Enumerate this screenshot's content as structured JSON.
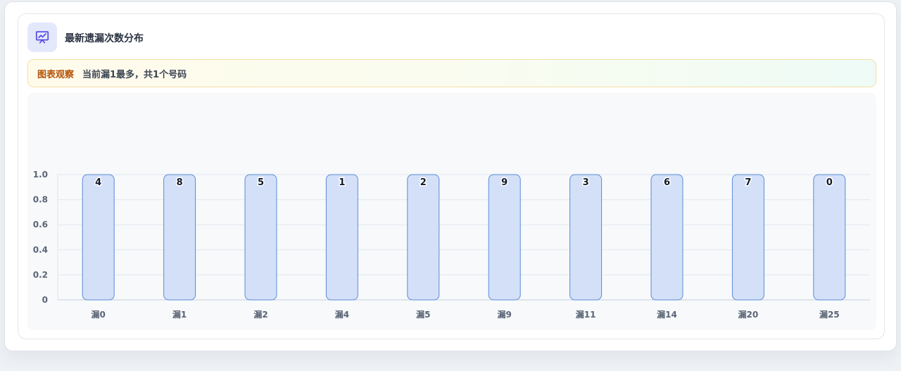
{
  "header": {
    "title": "最新遗漏次数分布",
    "icon": "presentation-chart-icon"
  },
  "observation": {
    "label": "图表观察",
    "text": "当前漏1最多，共1个号码"
  },
  "colors": {
    "bar_fill": "#d3e0f8",
    "bar_stroke": "#5b8bd9",
    "axis_text": "#5b6576",
    "label_text": "#111827"
  },
  "chart_data": {
    "type": "bar",
    "title": "最新遗漏次数分布",
    "categories": [
      "漏0",
      "漏1",
      "漏2",
      "漏4",
      "漏5",
      "漏9",
      "漏11",
      "漏14",
      "漏20",
      "漏25"
    ],
    "values": [
      1,
      1,
      1,
      1,
      1,
      1,
      1,
      1,
      1,
      1
    ],
    "data_labels": [
      "4",
      "8",
      "5",
      "1",
      "2",
      "9",
      "3",
      "6",
      "7",
      "0"
    ],
    "y_ticks": [
      "0",
      "0.2",
      "0.4",
      "0.6",
      "0.8",
      "1.0"
    ],
    "ylim": [
      0,
      1
    ],
    "xlabel": "",
    "ylabel": "",
    "grid": true,
    "legend": "none"
  }
}
